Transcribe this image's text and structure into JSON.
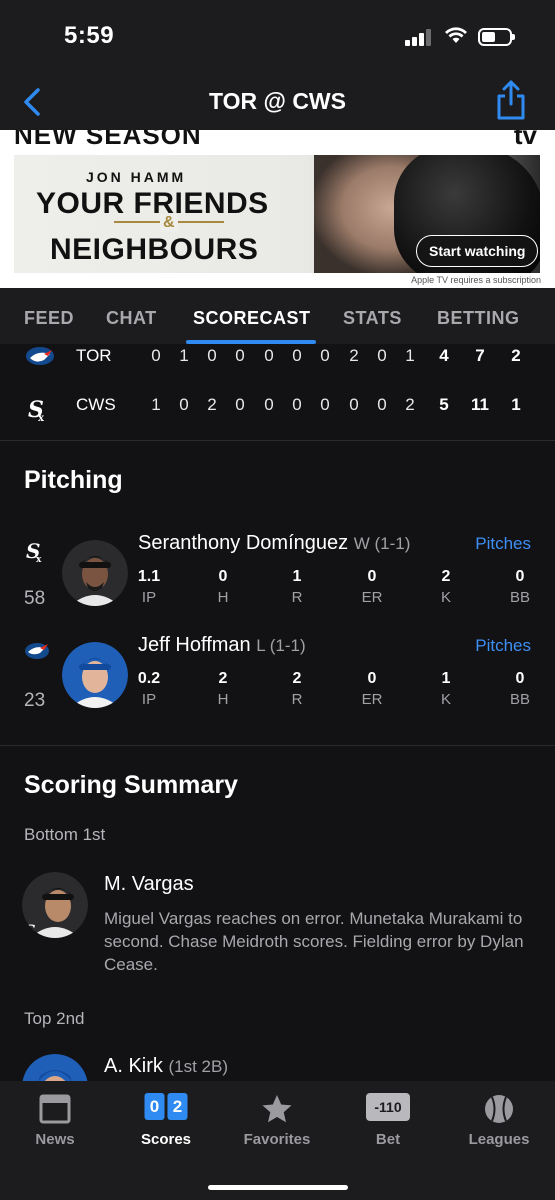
{
  "status_bar": {
    "time": "5:59"
  },
  "nav": {
    "title": "TOR @ CWS"
  },
  "ad": {
    "top_left": "NEW SEASON",
    "top_right": "tv",
    "small_name": "JON HAMM",
    "line1": "YOUR FRIENDS",
    "amp": "&",
    "line2": "NEIGHBOURS",
    "button": "Start watching",
    "disclaimer": "Apple TV requires a subscription"
  },
  "tabs": [
    "FEED",
    "CHAT",
    "SCORECAST",
    "STATS",
    "BETTING"
  ],
  "active_tab": "SCORECAST",
  "linescore": {
    "rows": [
      {
        "team": "TOR",
        "innings": [
          "0",
          "1",
          "0",
          "0",
          "0",
          "0",
          "0",
          "2",
          "0",
          "1"
        ],
        "r": "4",
        "h": "7",
        "e": "2"
      },
      {
        "team": "CWS",
        "innings": [
          "1",
          "0",
          "2",
          "0",
          "0",
          "0",
          "0",
          "0",
          "0",
          "2"
        ],
        "r": "5",
        "h": "11",
        "e": "1"
      }
    ]
  },
  "pitching": {
    "title": "Pitching",
    "pitchers": [
      {
        "team": "CWS",
        "number": "58",
        "name": "Seranthony Domínguez",
        "decision": "W (1-1)",
        "link": "Pitches",
        "stats": [
          {
            "label": "IP",
            "value": "1.1"
          },
          {
            "label": "H",
            "value": "0"
          },
          {
            "label": "R",
            "value": "1"
          },
          {
            "label": "ER",
            "value": "0"
          },
          {
            "label": "K",
            "value": "2"
          },
          {
            "label": "BB",
            "value": "0"
          }
        ]
      },
      {
        "team": "TOR",
        "number": "23",
        "name": "Jeff Hoffman",
        "decision": "L (1-1)",
        "link": "Pitches",
        "stats": [
          {
            "label": "IP",
            "value": "0.2"
          },
          {
            "label": "H",
            "value": "2"
          },
          {
            "label": "R",
            "value": "2"
          },
          {
            "label": "ER",
            "value": "0"
          },
          {
            "label": "K",
            "value": "1"
          },
          {
            "label": "BB",
            "value": "0"
          }
        ]
      }
    ]
  },
  "scoring": {
    "title": "Scoring Summary",
    "plays": [
      {
        "inning": "Bottom 1st",
        "player": "M. Vargas",
        "note": "",
        "description": "Miguel Vargas reaches on error. Munetaka Murakami to second. Chase Meidroth scores. Fielding error by Dylan Cease."
      },
      {
        "inning": "Top 2nd",
        "player": "A. Kirk",
        "note": "(1st 2B)",
        "description": ""
      }
    ]
  },
  "tabbar": {
    "items": [
      {
        "label": "News"
      },
      {
        "label": "Scores",
        "digits": [
          "0",
          "2"
        ]
      },
      {
        "label": "Favorites"
      },
      {
        "label": "Bet",
        "badge": "-110"
      },
      {
        "label": "Leagues"
      }
    ],
    "active": "Scores"
  },
  "colors": {
    "accent": "#2f8bf1",
    "link": "#3d8ff5",
    "background": "#121214",
    "bar": "#1c1c1e"
  }
}
